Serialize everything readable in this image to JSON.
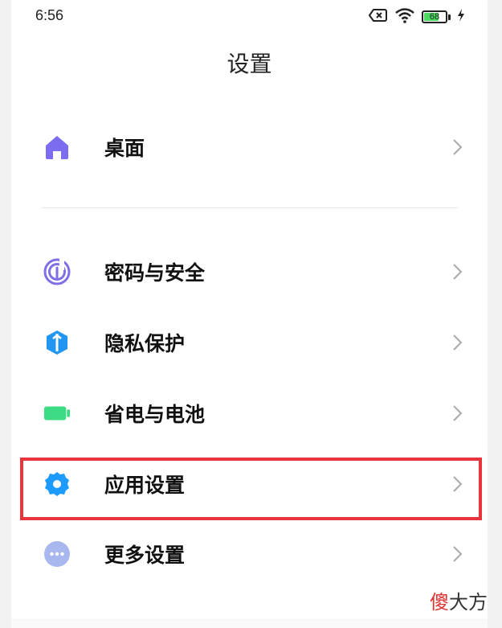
{
  "status_bar": {
    "time": "6:56",
    "battery_level": "68",
    "battery_percent": 68,
    "icons": [
      "no-sim-icon",
      "wifi-icon",
      "battery-icon",
      "charging-icon"
    ]
  },
  "header": {
    "title": "设置"
  },
  "settings": {
    "items": [
      {
        "label": "桌面",
        "icon": "home-icon",
        "color": "#7b6cf0"
      },
      {
        "label": "密码与安全",
        "icon": "fingerprint-icon",
        "color": "#7e6fe8"
      },
      {
        "label": "隐私保护",
        "icon": "privacy-shield-icon",
        "color": "#2196f3"
      },
      {
        "label": "省电与电池",
        "icon": "battery-green-icon",
        "color": "#3ddc84"
      },
      {
        "label": "应用设置",
        "icon": "gear-icon",
        "color": "#1e9bff"
      },
      {
        "label": "更多设置",
        "icon": "more-dots-icon",
        "color": "#a8b8ee"
      }
    ]
  },
  "watermark": {
    "first_char": "傻",
    "rest": "大方"
  },
  "colors": {
    "highlight": "#e8343a",
    "chevron": "#aaaaaa"
  }
}
